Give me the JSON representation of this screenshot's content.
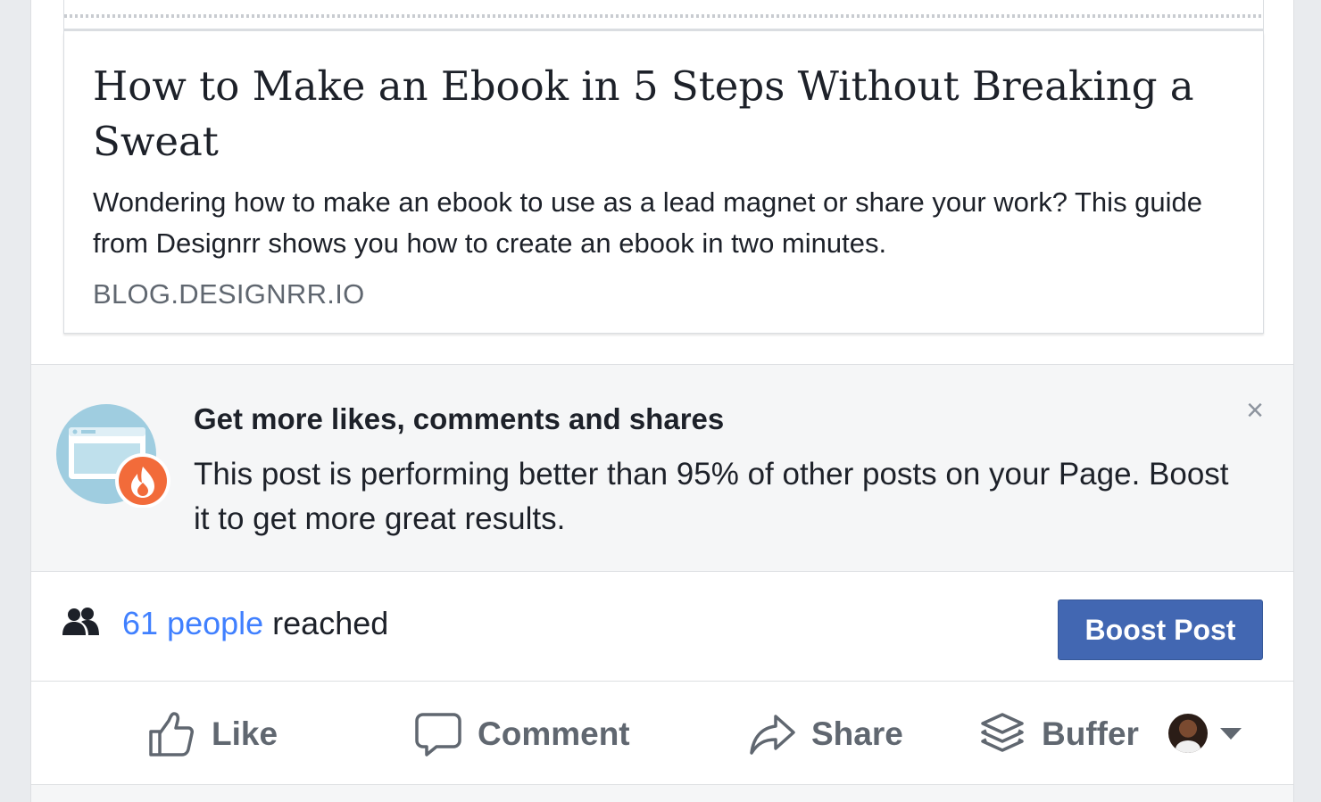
{
  "link_preview": {
    "title": "How to Make an Ebook in 5 Steps Without Breaking a Sweat",
    "description": "Wondering how to make an ebook to use as a lead magnet or share your work? This guide from Designrr shows you how to create an ebook in two minutes.",
    "domain": "BLOG.DESIGNRR.IO"
  },
  "boost_suggestion": {
    "title": "Get more likes, comments and shares",
    "body": "This post is performing better than 95% of other posts on your Page. Boost it to get more great results.",
    "dismiss_label": "×",
    "illustration_icon": "fire-badge-icon",
    "colors": {
      "illustration": "#9fcde0",
      "badge": "#f26b3a"
    }
  },
  "reach": {
    "count_link": "61 people",
    "suffix": " reached",
    "boost_button": "Boost Post",
    "icon": "people-icon"
  },
  "actions": {
    "like": "Like",
    "comment": "Comment",
    "share": "Share",
    "buffer": "Buffer"
  },
  "colors": {
    "accent": "#4267b2",
    "link": "#4080ff",
    "muted_text": "#606770",
    "text": "#1d2129"
  }
}
